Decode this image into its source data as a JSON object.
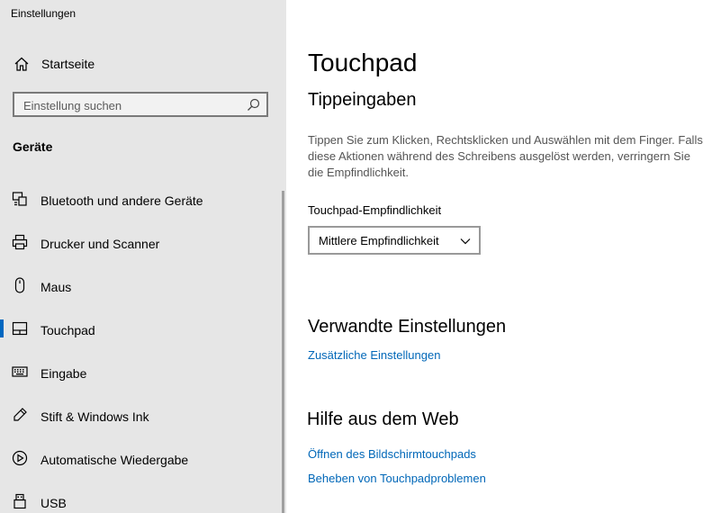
{
  "window": {
    "title": "Einstellungen"
  },
  "sidebar": {
    "home_label": "Startseite",
    "search": {
      "placeholder": "Einstellung suchen",
      "value": ""
    },
    "section_heading": "Geräte",
    "items": [
      {
        "label": "Bluetooth und andere Geräte",
        "icon": "bluetooth-devices-icon",
        "selected": false
      },
      {
        "label": "Drucker und Scanner",
        "icon": "printer-icon",
        "selected": false
      },
      {
        "label": "Maus",
        "icon": "mouse-icon",
        "selected": false
      },
      {
        "label": "Touchpad",
        "icon": "touchpad-icon",
        "selected": true
      },
      {
        "label": "Eingabe",
        "icon": "keyboard-icon",
        "selected": false
      },
      {
        "label": "Stift & Windows Ink",
        "icon": "pen-icon",
        "selected": false
      },
      {
        "label": "Automatische Wiedergabe",
        "icon": "autoplay-icon",
        "selected": false
      },
      {
        "label": "USB",
        "icon": "usb-icon",
        "selected": false
      }
    ]
  },
  "main": {
    "title": "Touchpad",
    "taps": {
      "heading": "Tippeingaben",
      "description": "Tippen Sie zum Klicken, Rechtsklicken und Auswählen mit dem Finger. Falls diese Aktionen während des Schreibens ausgelöst werden, verringern Sie die Empfindlichkeit.",
      "sensitivity_label": "Touchpad-Empfindlichkeit",
      "sensitivity_value": "Mittlere Empfindlichkeit"
    },
    "related": {
      "heading": "Verwandte Einstellungen",
      "link": "Zusätzliche Einstellungen"
    },
    "help": {
      "heading": "Hilfe aus dem Web",
      "links": [
        "Öffnen des Bildschirmtouchpads",
        "Beheben von Touchpadproblemen"
      ]
    }
  },
  "colors": {
    "accent": "#0067c0",
    "link": "#0067b8",
    "sidebar_bg": "#e6e6e6"
  }
}
